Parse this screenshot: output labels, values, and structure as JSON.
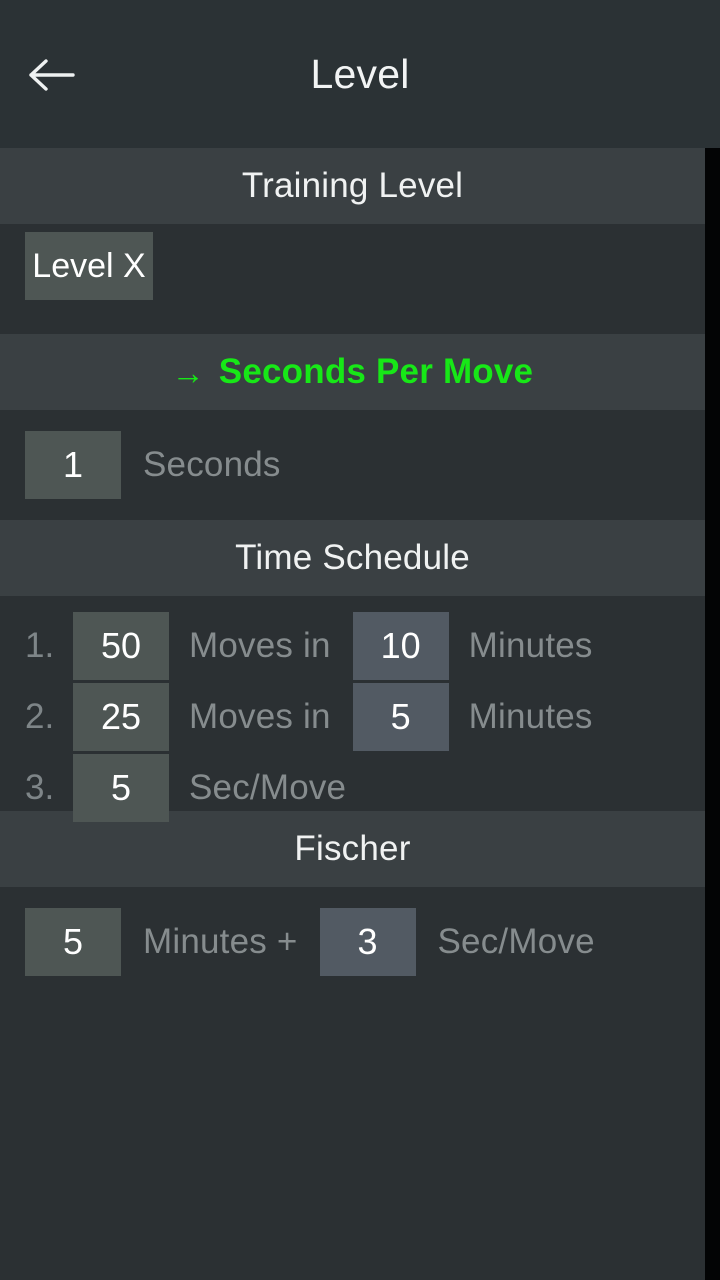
{
  "appbar": {
    "title": "Level",
    "back_icon": "arrow-left-icon"
  },
  "theme": {
    "accent_green": "#17e817",
    "header_bg": "#3a4043",
    "content_bg": "#2b3033",
    "chip_bg": "#4e5654",
    "chip_bg_alt": "#525a63",
    "label_color": "#868c8e",
    "title_color": "#f0f2f2"
  },
  "sections": {
    "training_level": {
      "header": "Training Level",
      "active": false,
      "level_value": "Level X"
    },
    "seconds_per_move": {
      "header": "Seconds Per Move",
      "arrow_glyph": "→",
      "active": true,
      "value": "1",
      "unit_label": "Seconds"
    },
    "time_schedule": {
      "header": "Time Schedule",
      "active": false,
      "rows": [
        {
          "index": "1.",
          "moves": "50",
          "moves_label": "Moves in",
          "time": "10",
          "time_label": "Minutes"
        },
        {
          "index": "2.",
          "moves": "25",
          "moves_label": "Moves in",
          "time": "5",
          "time_label": "Minutes"
        },
        {
          "index": "3.",
          "moves": "5",
          "moves_label": "Sec/Move",
          "time": "",
          "time_label": ""
        }
      ]
    },
    "fischer": {
      "header": "Fischer",
      "active": false,
      "minutes": "5",
      "minutes_label": "Minutes +",
      "increment": "3",
      "increment_label": "Sec/Move"
    }
  }
}
